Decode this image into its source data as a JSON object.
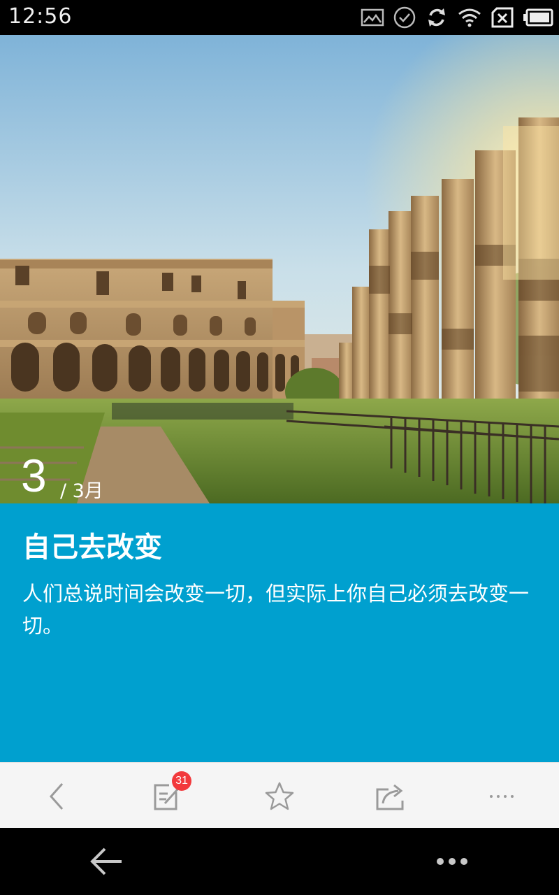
{
  "status_bar": {
    "time": "12:56",
    "icons": [
      "image-icon",
      "check-circle-icon",
      "sync-icon",
      "wifi-icon",
      "sim-x-icon",
      "battery-icon"
    ]
  },
  "hero": {
    "day": "3",
    "month": "/ 3月"
  },
  "card": {
    "title": "自己去改变",
    "body": "人们总说时间会改变一切，但实际上你自己必须去改变一切。",
    "background_color": "#00a0cf"
  },
  "toolbar": {
    "items": [
      "back-icon",
      "comment-icon",
      "star-icon",
      "share-icon",
      "more-icon"
    ],
    "comment_count": "31",
    "badge_color": "#f2393c"
  },
  "navbar": {
    "items": [
      "nav-back-icon",
      "nav-menu-icon"
    ]
  }
}
